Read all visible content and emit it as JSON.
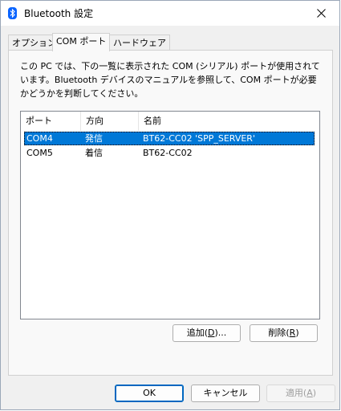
{
  "window": {
    "title": "Bluetooth 設定"
  },
  "tabs": [
    {
      "label": "オプション"
    },
    {
      "label": "COM ポート"
    },
    {
      "label": "ハードウェア"
    }
  ],
  "description": "この PC では、下の一覧に表示された COM (シリアル) ポートが使用されています。Bluetooth デバイスのマニュアルを参照して、COM ポートが必要かどうかを判断してください。",
  "list": {
    "columns": [
      "ポート",
      "方向",
      "名前"
    ],
    "rows": [
      {
        "port": "COM4",
        "direction": "発信",
        "name": "BT62-CC02 'SPP_SERVER'",
        "selected": true
      },
      {
        "port": "COM5",
        "direction": "着信",
        "name": "BT62-CC02",
        "selected": false
      }
    ]
  },
  "buttons": {
    "add_prefix": "追加(",
    "add_key": "D",
    "add_suffix": ")...",
    "remove_prefix": "削除(",
    "remove_key": "R",
    "remove_suffix": ")",
    "ok": "OK",
    "cancel": "キャンセル",
    "apply_prefix": "適用(",
    "apply_key": "A",
    "apply_suffix": ")"
  },
  "colors": {
    "selection": "#0078d7",
    "bluetooth": "#0a64ff"
  },
  "icons": {
    "app": "bluetooth-icon",
    "close": "close-icon"
  }
}
